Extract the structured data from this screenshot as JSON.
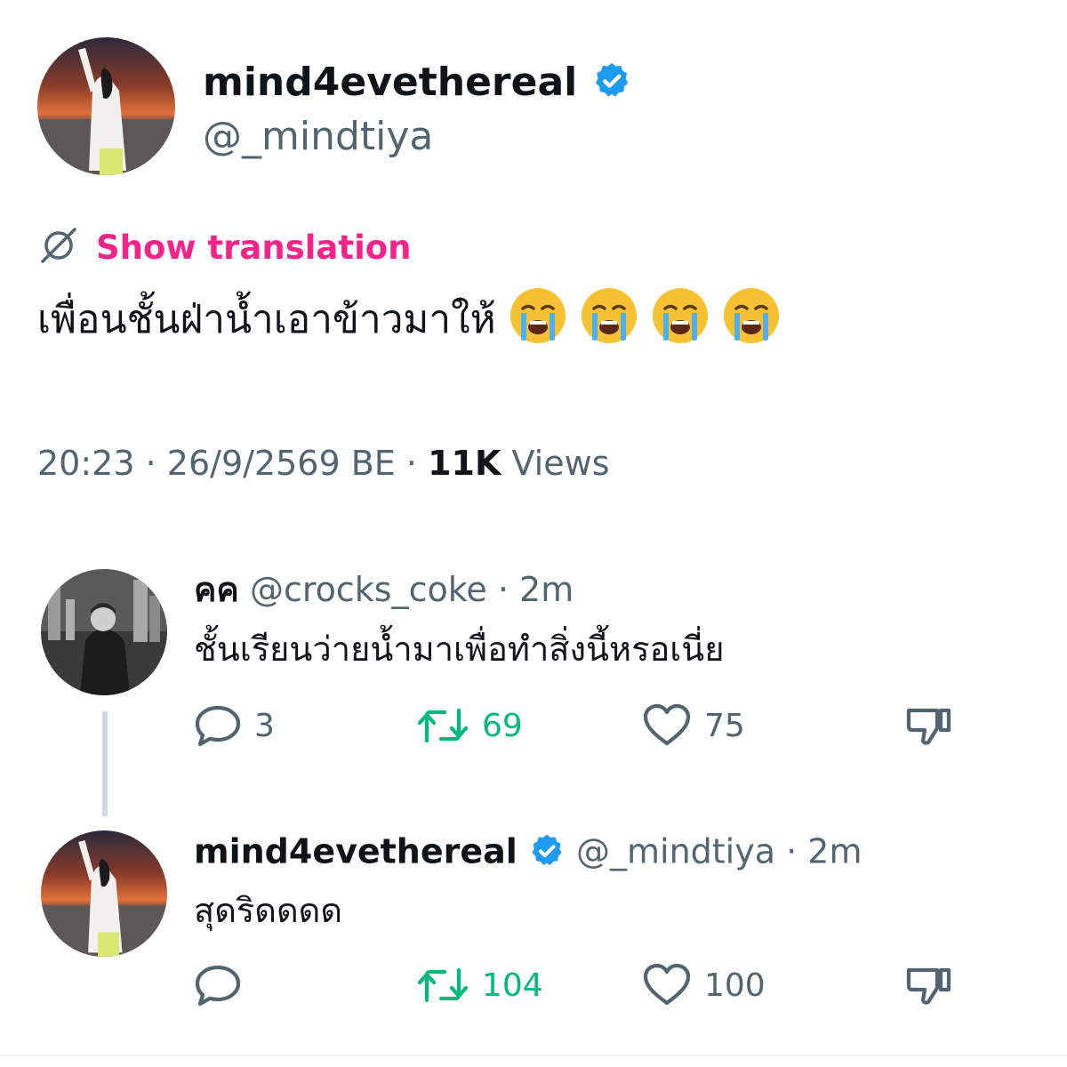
{
  "main_tweet": {
    "author": {
      "name": "mind4evethereal",
      "handle": "@_mindtiya",
      "verified": true
    },
    "translation_link": "Show translation",
    "text": "เพื่อนชั้นฝ่าน้ำเอาข้าวมาให้",
    "emoji_count": 4,
    "emoji": "loudly-crying-face",
    "meta": {
      "time": "20:23",
      "sep1": "·",
      "date": "26/9/2569 BE",
      "sep2": "·",
      "views_count": "11K",
      "views_label": "Views"
    }
  },
  "replies": [
    {
      "name": "คค",
      "handle": "@crocks_coke",
      "sep": "·",
      "time": "2m",
      "verified": false,
      "text": "ชั้นเรียนว่ายน้ำมาเพื่อทำสิ่งนี้หรอเนี่ย",
      "actions": {
        "reply_count": "3",
        "retweet_count": "69",
        "like_count": "75"
      }
    },
    {
      "name": "mind4evethereal",
      "handle": "@_mindtiya",
      "sep": "·",
      "time": "2m",
      "verified": true,
      "text": "สุดริดดดด",
      "actions": {
        "reply_count": "",
        "retweet_count": "104",
        "like_count": "100"
      }
    }
  ],
  "colors": {
    "text": "#0f1419",
    "secondary": "#536471",
    "verified_blue": "#1d9bf0",
    "translate_pink": "#f3238a",
    "retweet_green": "#00ba7c",
    "thread_line": "#cfd9de"
  },
  "icons": {
    "translate": "translate-globe-icon",
    "verified": "verified-badge-icon",
    "reply": "reply-bubble-icon",
    "retweet": "retweet-arrows-icon",
    "like": "heart-icon",
    "dislike": "thumbs-down-icon"
  }
}
